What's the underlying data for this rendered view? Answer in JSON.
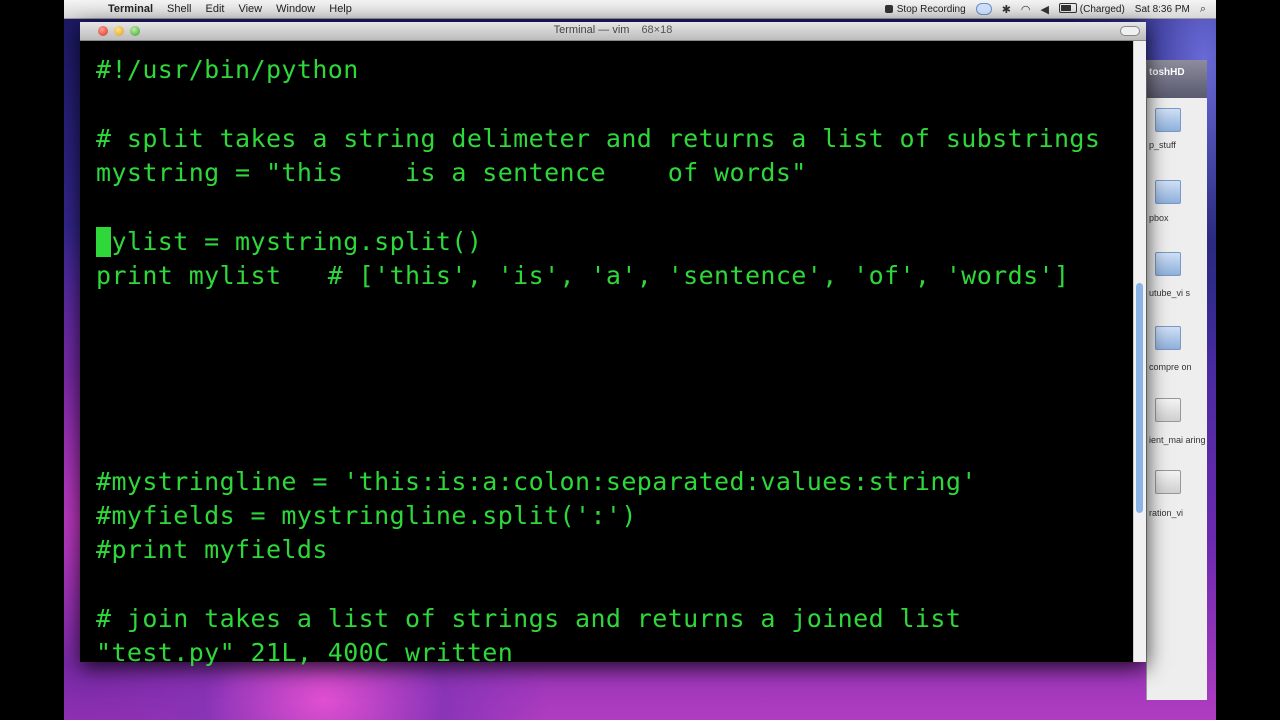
{
  "menubar": {
    "apple_glyph": "",
    "app_name": "Terminal",
    "menus": [
      "Shell",
      "Edit",
      "View",
      "Window",
      "Help"
    ],
    "stop_recording": "Stop Recording",
    "battery_status": "(Charged)",
    "clock": "Sat 8:36 PM",
    "search_glyph": "⌕"
  },
  "window": {
    "title": "Terminal — vim",
    "title_extra": "68×18"
  },
  "editor": {
    "lines": [
      "#!/usr/bin/python",
      "",
      "# split takes a string delimeter and returns a list of substrings",
      "mystring = \"this    is a sentence    of words\"",
      "",
      "mylist = mystring.split()",
      "print mylist   # ['this', 'is', 'a', 'sentence', 'of', 'words']",
      "",
      "",
      "",
      "",
      "",
      "#mystringline = 'this:is:a:colon:separated:values:string'",
      "#myfields = mystringline.split(':')",
      "#print myfields",
      "",
      "# join takes a list of strings and returns a joined list",
      "\"test.py\" 21L, 400C written"
    ],
    "cursor_line": 5,
    "cursor_col": 0,
    "text_color": "#2fd83a"
  },
  "finder": {
    "header": "toshHD",
    "items": [
      "p_stuff",
      "pbox",
      "utube_vi s",
      "compre on",
      "ient_mai aring",
      "ration_vi"
    ]
  },
  "scrollbar": {
    "position_fraction": 0.62
  }
}
